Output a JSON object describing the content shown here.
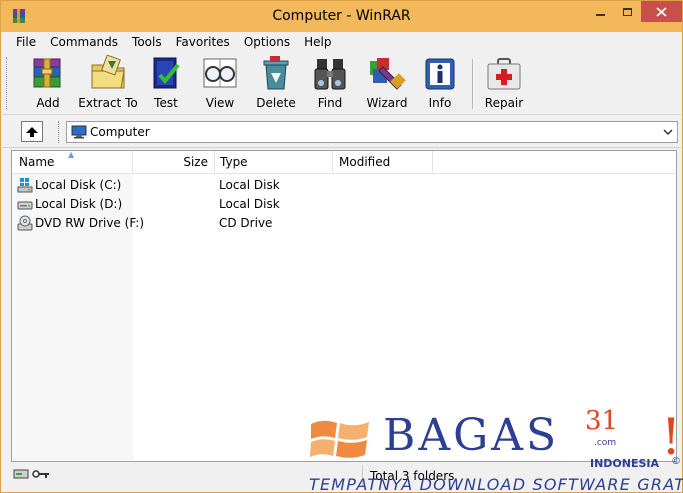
{
  "window": {
    "title": "Computer - WinRAR"
  },
  "menu": [
    "File",
    "Commands",
    "Tools",
    "Favorites",
    "Options",
    "Help"
  ],
  "toolbar": {
    "add": "Add",
    "extract": "Extract To",
    "test": "Test",
    "view": "View",
    "delete": "Delete",
    "find": "Find",
    "wizard": "Wizard",
    "info": "Info",
    "repair": "Repair"
  },
  "address": {
    "value": "Computer"
  },
  "columns": {
    "name": "Name",
    "size": "Size",
    "type": "Type",
    "modified": "Modified"
  },
  "rows": [
    {
      "name": "Local Disk (C:)",
      "type": "Local Disk",
      "icon": "windows-drive-icon"
    },
    {
      "name": "Local Disk (D:)",
      "type": "Local Disk",
      "icon": "hard-drive-icon"
    },
    {
      "name": "DVD RW Drive (F:)",
      "type": "CD Drive",
      "icon": "dvd-drive-icon"
    }
  ],
  "status": {
    "text": "Total 3 folders"
  },
  "watermark": {
    "brand": "BAGAS",
    "number": "31",
    "com": ".com",
    "exclaim": "!",
    "country": "INDONESIA",
    "copyright": "©",
    "tagline": "TEMPATNYA DOWNLOAD SOFTWARE GRATIS"
  },
  "colors": {
    "titlebar": "#f2b85a",
    "close": "#c7504a",
    "brand_blue": "#2d3f92",
    "brand_orange": "#e0461f"
  }
}
